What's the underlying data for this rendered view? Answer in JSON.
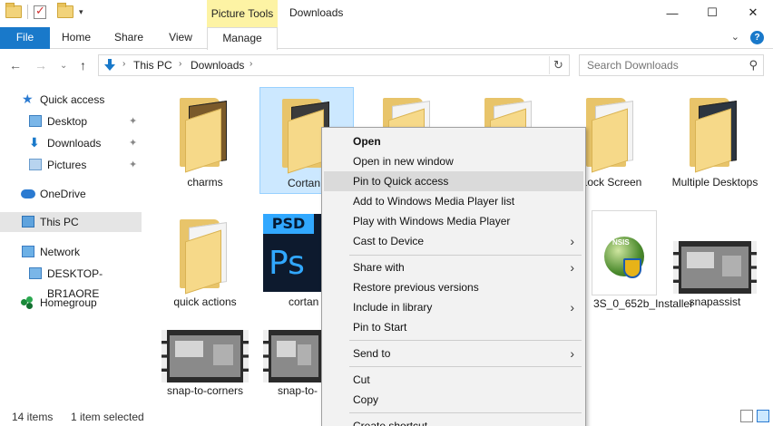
{
  "window": {
    "title": "Downloads",
    "contextual_tab_group": "Picture Tools",
    "minimize": "—",
    "maximize": "☐",
    "close": "✕"
  },
  "ribbon": {
    "tabs": [
      "File",
      "Home",
      "Share",
      "View",
      "Manage"
    ],
    "collapse": "⌄",
    "help": "?"
  },
  "address": {
    "back": "←",
    "forward": "→",
    "recent": "⌄",
    "up": "↑",
    "crumbs": [
      "This PC",
      "Downloads"
    ],
    "refresh": "↻"
  },
  "search": {
    "placeholder": "Search Downloads",
    "icon": "⚲"
  },
  "nav": {
    "items": [
      {
        "label": "Quick access",
        "icon": "star-icon"
      },
      {
        "label": "Desktop",
        "icon": "desktop-icon",
        "pinned": true
      },
      {
        "label": "Downloads",
        "icon": "downloads-icon",
        "pinned": true
      },
      {
        "label": "Pictures",
        "icon": "pictures-icon",
        "pinned": true
      },
      {
        "label": "OneDrive",
        "icon": "cloud-icon"
      },
      {
        "label": "This PC",
        "icon": "pc-icon",
        "selected": true
      },
      {
        "label": "Network",
        "icon": "network-icon"
      },
      {
        "label": "DESKTOP-BR1AORE",
        "icon": "computer-icon"
      },
      {
        "label": "Homegroup",
        "icon": "homegroup-icon"
      }
    ],
    "pin_glyph": "📌"
  },
  "files": [
    {
      "label": "charms"
    },
    {
      "label": "Cortan",
      "selected": true
    },
    {
      "label": ""
    },
    {
      "label": ""
    },
    {
      "label": "Lock Screen"
    },
    {
      "label": "Multiple Desktops"
    },
    {
      "label": "quick actions"
    },
    {
      "label": "cortan"
    },
    {
      "label": "3S_0_652b_Installer"
    },
    {
      "label": "snapassist"
    },
    {
      "label": "snap-to-corners"
    },
    {
      "label": "snap-to-"
    }
  ],
  "context_menu": {
    "items": [
      {
        "label": "Open",
        "bold": true
      },
      {
        "label": "Open in new window"
      },
      {
        "label": "Pin to Quick access",
        "highlighted": true
      },
      {
        "label": "Add to Windows Media Player list"
      },
      {
        "label": "Play with Windows Media Player"
      },
      {
        "label": "Cast to Device",
        "submenu": true
      },
      {
        "label": "Share with",
        "submenu": true
      },
      {
        "label": "Restore previous versions"
      },
      {
        "label": "Include in library",
        "submenu": true
      },
      {
        "label": "Pin to Start"
      },
      {
        "label": "Send to",
        "submenu": true
      },
      {
        "label": "Cut"
      },
      {
        "label": "Copy"
      },
      {
        "label": "Create shortcut"
      }
    ],
    "submenu_arrow": "›"
  },
  "status": {
    "item_count": "14 items",
    "selection": "1 item selected"
  },
  "colors": {
    "accent": "#1979ca",
    "contextual_tab": "#fdf3a4",
    "selection": "#cce8ff",
    "menu_bg": "#f2f2f2"
  }
}
